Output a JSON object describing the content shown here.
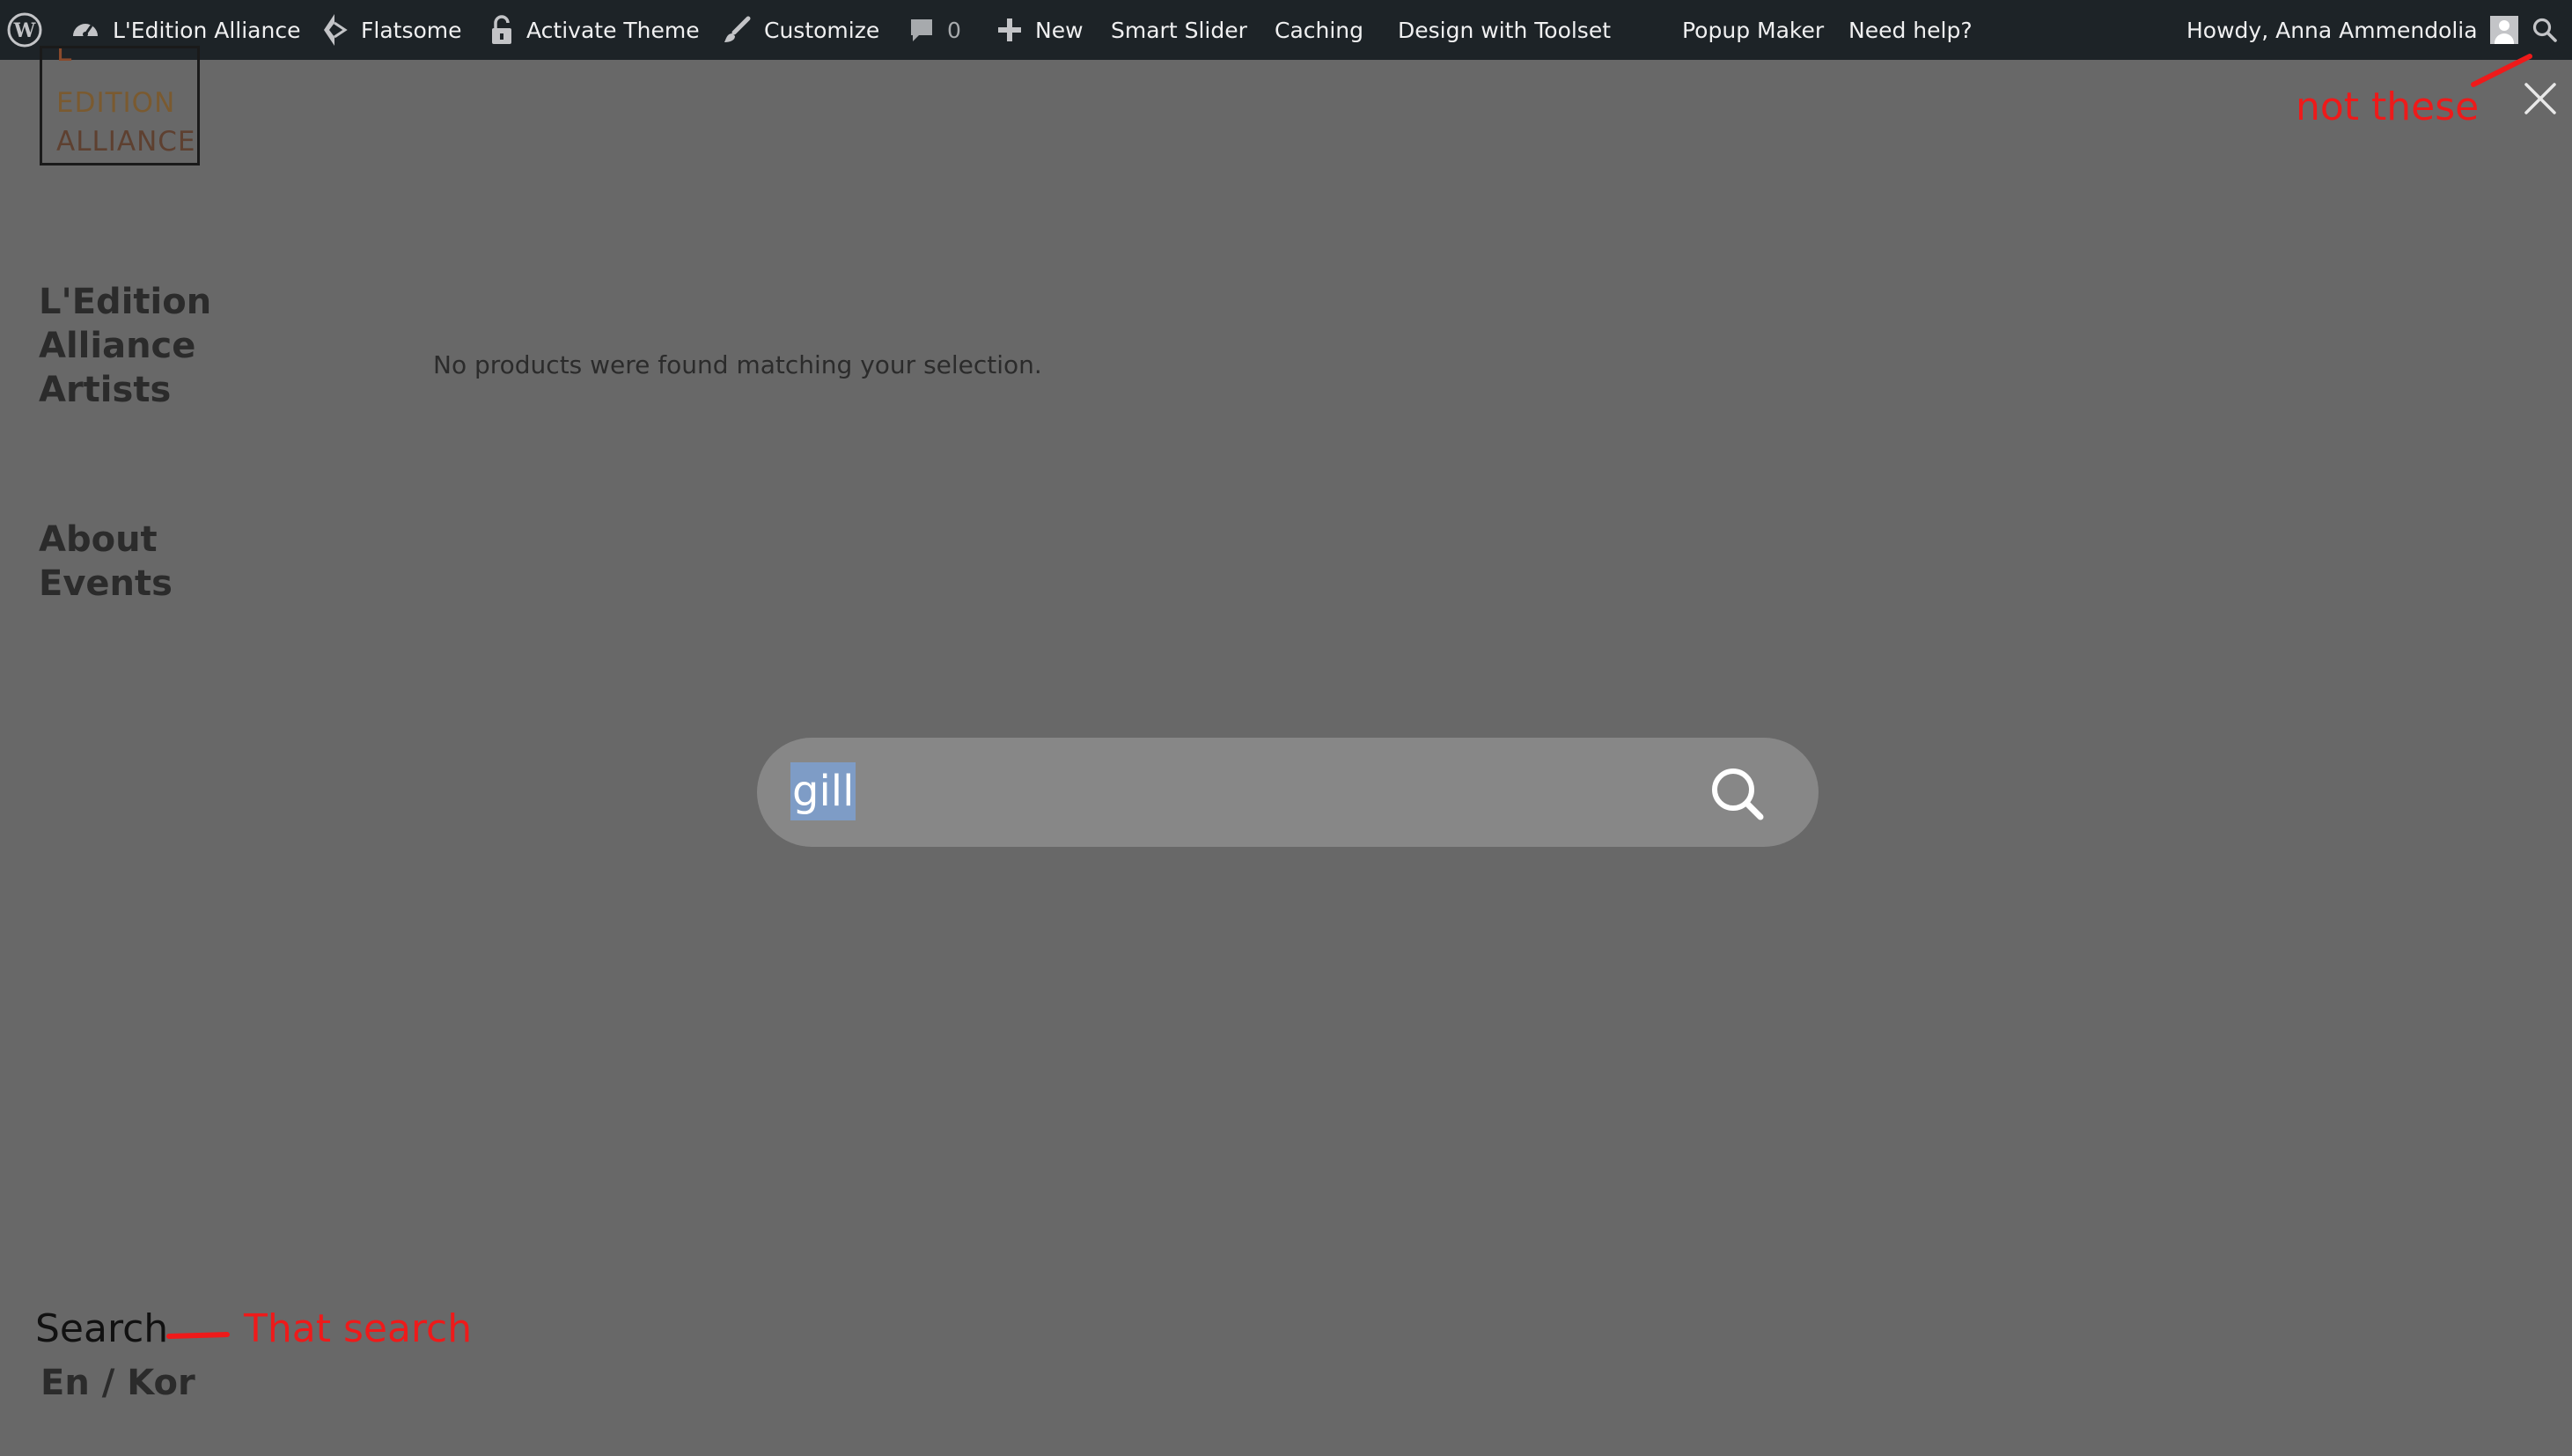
{
  "adminbar": {
    "site_name": "L'Edition Alliance",
    "theme": "Flatsome",
    "activate_theme": "Activate Theme",
    "customize": "Customize",
    "comments_count": "0",
    "new": "New",
    "smart_slider": "Smart Slider",
    "caching": "Caching",
    "design_toolset": "Design with Toolset",
    "popup_maker": "Popup Maker",
    "need_help": "Need help?",
    "howdy": "Howdy, Anna Ammendolia"
  },
  "logo": {
    "line1": "L",
    "line2": "EDITION",
    "line3": "ALLIANCE"
  },
  "sidenav": {
    "primary": [
      "L'Edition",
      "Alliance",
      "Artists"
    ],
    "secondary": [
      "About",
      "Events"
    ]
  },
  "main": {
    "notice": "No products were found matching your selection."
  },
  "search": {
    "value": "gill"
  },
  "footer": {
    "search_label": "Search",
    "language": "En / Kor"
  },
  "annotations": {
    "top": "not these",
    "bottom": "That search",
    "color": "#ee1a1a"
  },
  "colors": {
    "adminbar_bg": "#1d2327",
    "overlay_bg": "#686868",
    "search_field_bg": "#878787",
    "selection": "#7e9cc6"
  }
}
